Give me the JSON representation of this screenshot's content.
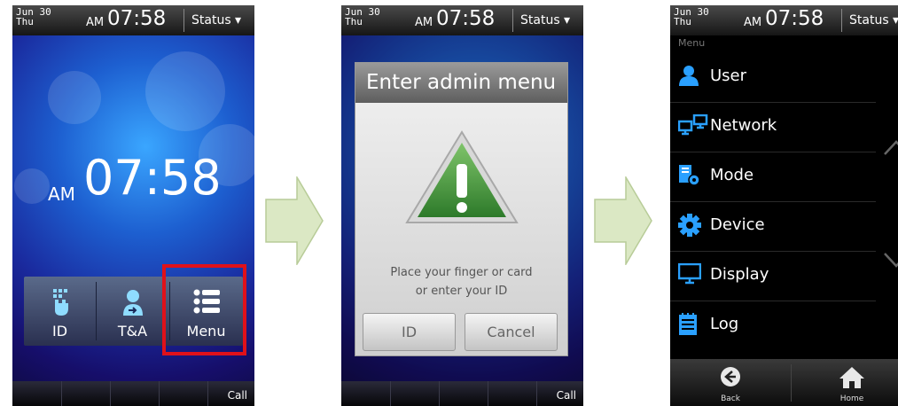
{
  "screens": [
    {
      "statusbar": {
        "month_day": "Jun  30",
        "weekday": "Thu",
        "ampm": "AM",
        "time": "07:58",
        "status": "Status ▾"
      },
      "clock": {
        "ampm": "AM",
        "time": "07:58"
      },
      "quick_buttons": [
        {
          "label": "ID",
          "icon": "fingerprint-hand-icon"
        },
        {
          "label": "T&A",
          "icon": "time-attendance-icon"
        },
        {
          "label": "Menu",
          "icon": "menu-list-icon"
        }
      ],
      "bottombar": {
        "call": "Call"
      }
    },
    {
      "statusbar": {
        "month_day": "Jun  30",
        "weekday": "Thu",
        "ampm": "AM",
        "time": "07:58",
        "status": "Status ▾"
      },
      "dialog": {
        "title": "Enter admin menu",
        "message_line1": "Place your finger or card",
        "message_line2": "or enter your ID",
        "id_button": "ID",
        "cancel_button": "Cancel"
      },
      "bottombar": {
        "call": "Call"
      }
    },
    {
      "statusbar": {
        "month_day": "Jun  30",
        "weekday": "Thu",
        "ampm": "AM",
        "time": "07:58",
        "status": "Status ▾"
      },
      "menu": {
        "header": "Menu",
        "items": [
          {
            "label": "User",
            "icon": "user-icon"
          },
          {
            "label": "Network",
            "icon": "network-icon"
          },
          {
            "label": "Mode",
            "icon": "mode-icon"
          },
          {
            "label": "Device",
            "icon": "gear-icon"
          },
          {
            "label": "Display",
            "icon": "monitor-icon"
          },
          {
            "label": "Log",
            "icon": "log-icon"
          }
        ]
      },
      "nav": {
        "back": "Back",
        "home": "Home"
      }
    }
  ],
  "colors": {
    "highlight": "#e0111a",
    "arrow": "#d7e6bd"
  }
}
